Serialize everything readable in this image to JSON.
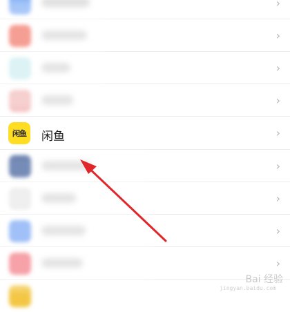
{
  "list": {
    "highlighted_app": {
      "icon_text": "闲鱼",
      "label": "闲鱼",
      "icon_color": "#ffdd22"
    },
    "chevron_glyph": "›"
  },
  "blurred_rows": [
    {
      "icon_color": "#7aaaf5"
    },
    {
      "icon_color": "#f06a5a"
    },
    {
      "icon_color": "#c9ecef"
    },
    {
      "icon_color": "#f2b6b6"
    },
    {
      "icon_color": "#2d4e8f"
    },
    {
      "icon_color": "#e6e6e6"
    },
    {
      "icon_color": "#6e9ff3"
    },
    {
      "icon_color": "#f2707a"
    }
  ],
  "annotation": {
    "arrow_color": "#e0262a"
  },
  "watermark": {
    "text": "Bai 经验",
    "sub": "jingyan.baidu.com"
  }
}
